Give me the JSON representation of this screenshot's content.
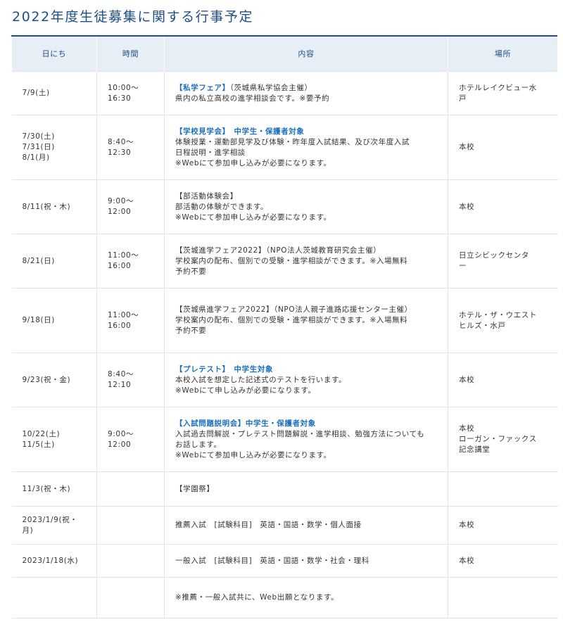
{
  "page": {
    "title": "2022年度生徒募集に関する行事予定"
  },
  "table": {
    "headers": {
      "date": "日にち",
      "time": "時間",
      "content": "内容",
      "place": "場所"
    },
    "rows": [
      {
        "date": [
          "7/9(土)"
        ],
        "time": [
          "10:00～",
          "16:30"
        ],
        "title": "【私学フェア】（茨城県私学協会主催）",
        "title_style": "blue-part",
        "title_blue": "【私学フェア】",
        "title_rest": "（茨城県私学協会主催）",
        "lines": [
          "県内の私立高校の進学相談会です。※要予約"
        ],
        "place": [
          "ホテルレイクビュー水",
          "戸"
        ]
      },
      {
        "date": [
          "7/30(土)",
          "7/31(日)",
          "8/1(月)"
        ],
        "time": [
          "8:40～",
          "12:30"
        ],
        "title_blue": "【学校見学会】　中学生・保護者対象",
        "title_rest": "",
        "lines": [
          "体験授業・運動部見学及び体験・昨年度入試結果、及び次年度入試",
          "日程説明・進学相談",
          "※Webにて参加申し込みが必要になります。"
        ],
        "place": [
          "本校"
        ]
      },
      {
        "date": [
          "8/11(祝・木)"
        ],
        "time": [
          "9:00～",
          "12:00"
        ],
        "title_blue": "",
        "title_rest": "【部活動体験会】",
        "lines": [
          "部活動の体験ができます。",
          "※Webにて参加申し込みが必要になります。"
        ],
        "place": [
          "本校"
        ]
      },
      {
        "date": [
          "8/21(日)"
        ],
        "time": [
          "11:00～",
          "16:00"
        ],
        "title_blue": "",
        "title_rest": "【茨城進学フェア2022】（NPO法人茨城教育研究会主催）",
        "lines": [
          "学校案内の配布、個別での受験・進学相談ができます。※入場無料",
          "予約不要"
        ],
        "place": [
          "日立シビックセンタ",
          "ー"
        ]
      },
      {
        "date": [
          "9/18(日)"
        ],
        "time": [
          "11:00～",
          "16:00"
        ],
        "title_blue": "",
        "title_rest": "【茨城県進学フェア2022】（NPO法人親子進路応援センター主催）",
        "lines": [
          "学校案内の配布、個別での受験・進学相談ができます。※入場無料",
          "予約不要"
        ],
        "place": [
          "ホテル・ザ・ウエスト",
          "ヒルズ・水戸"
        ]
      },
      {
        "date": [
          "9/23(祝・金)"
        ],
        "time": [
          "8:40～",
          "12:10"
        ],
        "title_blue": "【プレテスト】　中学生対象",
        "title_rest": "",
        "lines": [
          "本校入試を想定した記述式のテストを行います。",
          "※Webにて申し込みが必要になります。"
        ],
        "place": [
          "本校"
        ]
      },
      {
        "date": [
          "10/22(土)",
          "11/5(土)"
        ],
        "time": [
          "9:00～",
          "12:00"
        ],
        "title_blue": "【入試問題説明会】中学生・保護者対象",
        "title_rest": "",
        "lines": [
          "入試過去問解説・プレテスト問題解説・進学相談、勉強方法についても",
          "お話します。",
          "※Webにて参加申し込みが必要になります。"
        ],
        "place": [
          "本校",
          "ローガン・ファックス",
          "記念講堂"
        ]
      },
      {
        "date": [
          "11/3(祝・木)"
        ],
        "time": [],
        "title_blue": "",
        "title_rest": "【学園祭】",
        "lines": [],
        "place": []
      },
      {
        "date": [
          "2023/1/9(祝・",
          "月)"
        ],
        "time": [],
        "title_blue": "",
        "title_rest": "",
        "lines": [
          "推薦入試　[試験科目]　英語・国語・数学・個人面接"
        ],
        "place": [
          "本校"
        ]
      },
      {
        "date": [
          "2023/1/18(水)"
        ],
        "time": [],
        "title_blue": "",
        "title_rest": "",
        "lines": [
          "一般入試　[試験科目]　英語・国語・数学・社会・理科"
        ],
        "place": [
          "本校"
        ]
      },
      {
        "date": [],
        "time": [],
        "title_blue": "",
        "title_rest": "",
        "lines": [
          "※推薦・一般入試共に、Web出願となります。"
        ],
        "place": []
      }
    ]
  },
  "colors": {
    "accent": "#1e4d8c",
    "link_blue": "#1a6fc0",
    "header_bg": "#e8eef5",
    "border": "#dfe3e8"
  }
}
